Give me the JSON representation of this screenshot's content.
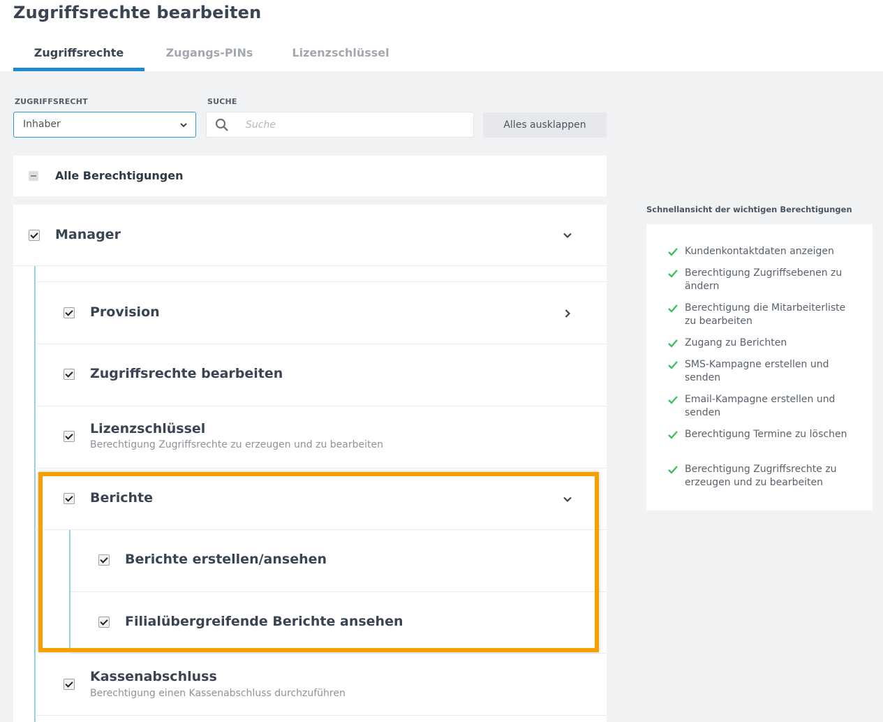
{
  "page": {
    "title": "Zugriffsrechte bearbeiten"
  },
  "tabs": [
    {
      "label": "Zugriffsrechte",
      "active": true
    },
    {
      "label": "Zugangs-PINs",
      "active": false
    },
    {
      "label": "Lizenzschlüssel",
      "active": false
    }
  ],
  "filters": {
    "role_label": "ZUGRIFFSRECHT",
    "role_value": "Inhaber",
    "search_label": "SUCHE",
    "search_placeholder": "Suche",
    "search_value": "",
    "expand_all": "Alles ausklappen"
  },
  "all_permissions": {
    "label": "Alle Berechtigungen",
    "state": "indeterminate"
  },
  "tree": {
    "manager": {
      "label": "Manager",
      "checked": true,
      "expanded": true
    },
    "items": [
      {
        "label": "Provision",
        "checked": true,
        "chevron": "right"
      },
      {
        "label": "Zugriffsrechte bearbeiten",
        "checked": true
      },
      {
        "label": "Lizenzschlüssel",
        "description": "Berechtigung Zugriffsrechte zu erzeugen und zu bearbeiten",
        "checked": true
      },
      {
        "label": "Berichte",
        "checked": true,
        "chevron": "down",
        "children": [
          {
            "label": "Berichte erstellen/ansehen",
            "checked": true
          },
          {
            "label": "Filialübergreifende Berichte ansehen",
            "checked": true
          }
        ]
      },
      {
        "label": "Kassenabschluss",
        "description": "Berechtigung einen Kassenabschluss durchzuführen",
        "checked": true
      }
    ]
  },
  "quick_view": {
    "heading": "Schnellansicht der wichtigen Berechtigungen",
    "items": [
      "Kundenkontaktdaten anzeigen",
      "Berechtigung Zugriffsebenen zu ändern",
      "Berechtigung die Mitarbeiterliste zu bearbeiten",
      "Zugang zu Berichten",
      "SMS-Kampagne erstellen und senden",
      "Email-Kampagne erstellen und senden",
      "Berechtigung Termine zu löschen",
      "Berechtigung Zugriffsrechte zu erzeugen und zu bearbeiten"
    ]
  },
  "colors": {
    "accent": "#1a8ccf",
    "tree_line": "#8fd3e6",
    "highlight": "#f5a000",
    "check_green": "#3fbf5a"
  }
}
